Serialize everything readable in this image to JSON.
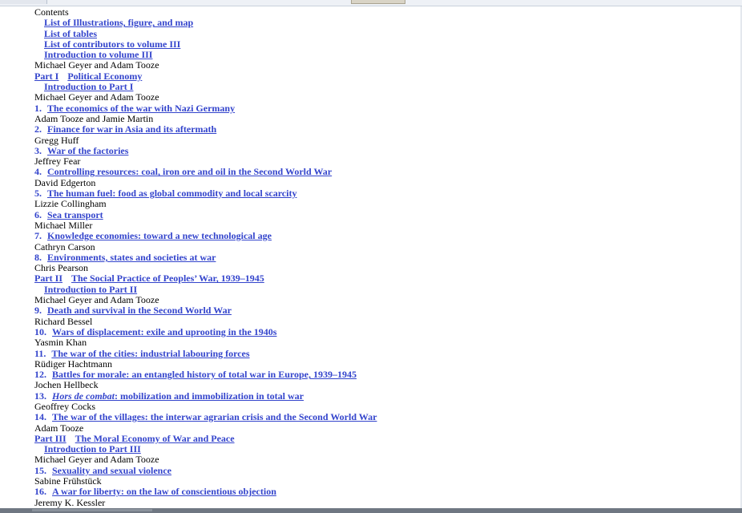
{
  "heading": "Contents",
  "front_matter": [
    "List of Illustrations, figure, and map",
    "List of tables",
    "List of contributors to volume III",
    "Introduction to volume III"
  ],
  "front_author": "Michael Geyer and Adam Tooze",
  "parts": [
    {
      "label": "Part I",
      "title": "Political Economy",
      "intro": "Introduction to Part I",
      "intro_author": "Michael Geyer and Adam Tooze",
      "chapters": [
        {
          "num": "1.",
          "title": "The economics of the war with Nazi Germany",
          "author": "Adam Tooze and Jamie Martin"
        },
        {
          "num": "2.",
          "title": "Finance for war in Asia and its aftermath",
          "author": "Gregg Huff"
        },
        {
          "num": "3.",
          "title": "War of the factories",
          "author": "Jeffrey Fear"
        },
        {
          "num": "4.",
          "title": "Controlling resources: coal, iron ore and oil in the Second World War",
          "author": "David Edgerton"
        },
        {
          "num": "5.",
          "title": "The human fuel: food as global commodity and local scarcity",
          "author": "Lizzie Collingham"
        },
        {
          "num": "6.",
          "title": "Sea transport",
          "author": "Michael Miller"
        },
        {
          "num": "7.",
          "title": "Knowledge economies: toward a new technological age",
          "author": "Cathryn Carson"
        },
        {
          "num": "8.",
          "title": "Environments, states and societies at war",
          "author": "Chris Pearson"
        }
      ]
    },
    {
      "label": "Part II",
      "title": "The Social Practice of Peoples’ War, 1939–1945",
      "intro": "Introduction to Part II",
      "intro_author": "Michael Geyer and Adam Tooze",
      "chapters": [
        {
          "num": "9.",
          "title": "Death and survival in the Second World War",
          "author": "Richard Bessel"
        },
        {
          "num": "10.",
          "title": "Wars of displacement: exile and uprooting in the 1940s",
          "author": "Yasmin Khan"
        },
        {
          "num": "11.",
          "title": "The war of the cities: industrial labouring forces",
          "author": "Rüdiger Hachtmann"
        },
        {
          "num": "12.",
          "title": "Battles for morale: an entangled history of total war in Europe, 1939–1945",
          "author": "Jochen Hellbeck"
        },
        {
          "num": "13.",
          "title_italic": "Hors de combat",
          "title": ": mobilization and immobilization in total war",
          "author": "Geoffrey Cocks"
        },
        {
          "num": "14.",
          "title": "The war of the villages: the interwar agrarian crisis and the Second World War",
          "author": "Adam Tooze"
        }
      ]
    },
    {
      "label": "Part III",
      "title": "The Moral Economy of War and Peace",
      "intro": "Introduction to Part III",
      "intro_author": "Michael Geyer and Adam Tooze",
      "chapters": [
        {
          "num": "15.",
          "title": "Sexuality and sexual violence",
          "author": "Sabine Frühstück"
        },
        {
          "num": "16.",
          "title": "A war for liberty: on the law of conscientious objection",
          "author": "Jeremy K. Kessler"
        }
      ]
    }
  ],
  "colors": {
    "link": "#3344cc",
    "text": "#000000",
    "background": "#ffffff"
  }
}
